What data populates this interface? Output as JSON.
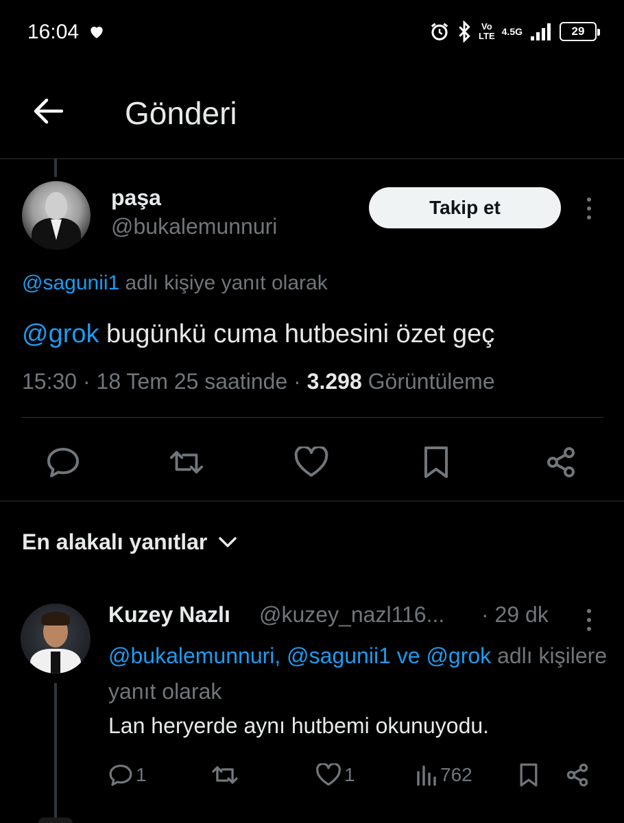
{
  "status_bar": {
    "time": "16:04",
    "volte": "Vo\nLTE",
    "network": "4.5G",
    "battery": "29"
  },
  "header": {
    "title": "Gönderi"
  },
  "post": {
    "name": "paşa",
    "handle": "@bukalemunnuri",
    "follow_label": "Takip et",
    "reply_to_user": "@sagunii1",
    "reply_to_suffix": " adlı kişiye yanıt olarak",
    "mention": "@grok",
    "text": " bugünkü cuma hutbesini özet geç",
    "time": "15:30",
    "sep1": " · ",
    "date": "18 Tem 25 saatinde",
    "sep2": " · ",
    "views": "3.298",
    "views_label": " Görüntüleme"
  },
  "sort": {
    "label": "En alakalı yanıtlar"
  },
  "reply": {
    "name": "Kuzey Nazlı",
    "handle": "@kuzey_nazl116...",
    "time": "· 29 dk",
    "mentions": "@bukalemunnuri, @sagunii1 ve @grok",
    "mentions_suffix": " adlı kişilere yanıt olarak",
    "text": "Lan heryerde aynı hutbemi okunuyodu.",
    "reply_count": "1",
    "like_count": "1",
    "view_count": "762"
  },
  "colors": {
    "background": "#000000",
    "text": "#e7e9ea",
    "secondary": "#71767b",
    "link": "#1d9bf0",
    "divider": "#2f3336"
  },
  "icons": [
    "heart-icon",
    "alarm-icon",
    "bluetooth-icon",
    "signal-icon",
    "back-arrow-icon",
    "more-vert-icon",
    "comment-icon",
    "retweet-icon",
    "like-icon",
    "bookmark-icon",
    "share-icon",
    "chevron-down-icon",
    "analytics-icon"
  ]
}
